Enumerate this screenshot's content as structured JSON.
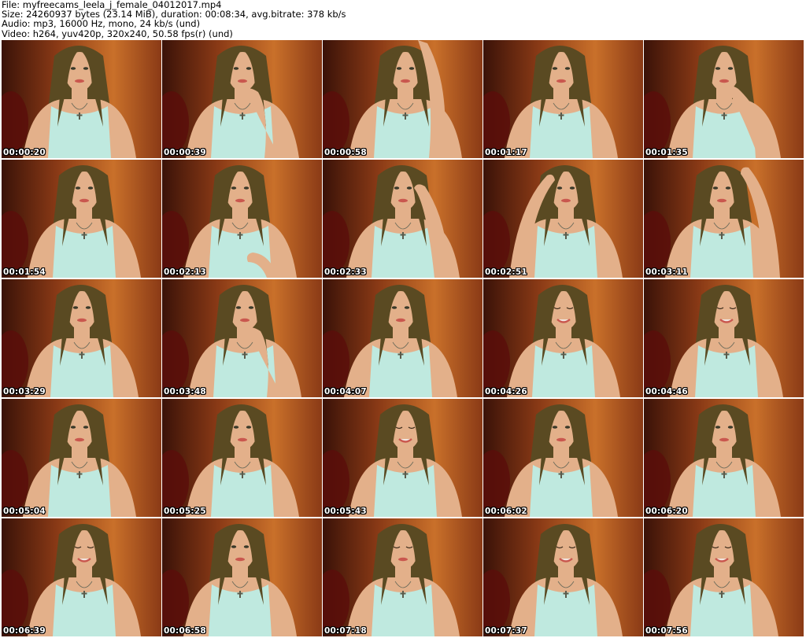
{
  "header": {
    "lines": [
      "File: myfreecams_leela_j_female_04012017.mp4",
      "Size: 24260937 bytes (23.14 MiB), duration: 00:08:34, avg.bitrate: 378 kb/s",
      "Audio: mp3, 16000 Hz, mono, 24 kb/s (und)",
      "Video: h264, yuv420p, 320x240, 50.58 fps(r) (und)"
    ]
  },
  "colors": {
    "background_dark": "#3a1208",
    "background_mid": "#8a3a16",
    "background_warm": "#c9702a",
    "hair": "#5a4a22",
    "skin": "#e3b08a",
    "top": "#bfe9df",
    "lips": "#c9574e"
  },
  "thumbnails": [
    {
      "timestamp": "00:00:20",
      "icon": "video-frame-thumbnail",
      "pose": "neutral"
    },
    {
      "timestamp": "00:00:39",
      "icon": "video-frame-thumbnail",
      "pose": "hand-chin"
    },
    {
      "timestamp": "00:00:58",
      "icon": "video-frame-thumbnail",
      "pose": "arm-up"
    },
    {
      "timestamp": "00:01:17",
      "icon": "video-frame-thumbnail",
      "pose": "neutral"
    },
    {
      "timestamp": "00:01:35",
      "icon": "video-frame-thumbnail",
      "pose": "hand-mouth"
    },
    {
      "timestamp": "00:01:54",
      "icon": "video-frame-thumbnail",
      "pose": "neutral"
    },
    {
      "timestamp": "00:02:13",
      "icon": "video-frame-thumbnail",
      "pose": "hand-chest"
    },
    {
      "timestamp": "00:02:33",
      "icon": "video-frame-thumbnail",
      "pose": "hand-eye"
    },
    {
      "timestamp": "00:02:51",
      "icon": "video-frame-thumbnail",
      "pose": "hand-head-left"
    },
    {
      "timestamp": "00:03:11",
      "icon": "video-frame-thumbnail",
      "pose": "hand-head-right"
    },
    {
      "timestamp": "00:03:29",
      "icon": "video-frame-thumbnail",
      "pose": "neutral"
    },
    {
      "timestamp": "00:03:48",
      "icon": "video-frame-thumbnail",
      "pose": "hand-chin"
    },
    {
      "timestamp": "00:04:07",
      "icon": "video-frame-thumbnail",
      "pose": "neutral"
    },
    {
      "timestamp": "00:04:26",
      "icon": "video-frame-thumbnail",
      "pose": "smile"
    },
    {
      "timestamp": "00:04:46",
      "icon": "video-frame-thumbnail",
      "pose": "smile"
    },
    {
      "timestamp": "00:05:04",
      "icon": "video-frame-thumbnail",
      "pose": "neutral"
    },
    {
      "timestamp": "00:05:25",
      "icon": "video-frame-thumbnail",
      "pose": "neutral"
    },
    {
      "timestamp": "00:05:43",
      "icon": "video-frame-thumbnail",
      "pose": "smile"
    },
    {
      "timestamp": "00:06:02",
      "icon": "video-frame-thumbnail",
      "pose": "neutral"
    },
    {
      "timestamp": "00:06:20",
      "icon": "video-frame-thumbnail",
      "pose": "neutral"
    },
    {
      "timestamp": "00:06:39",
      "icon": "video-frame-thumbnail",
      "pose": "smile"
    },
    {
      "timestamp": "00:06:58",
      "icon": "video-frame-thumbnail",
      "pose": "neutral"
    },
    {
      "timestamp": "00:07:18",
      "icon": "video-frame-thumbnail",
      "pose": "eyes-closed"
    },
    {
      "timestamp": "00:07:37",
      "icon": "video-frame-thumbnail",
      "pose": "smile"
    },
    {
      "timestamp": "00:07:56",
      "icon": "video-frame-thumbnail",
      "pose": "smile"
    }
  ]
}
